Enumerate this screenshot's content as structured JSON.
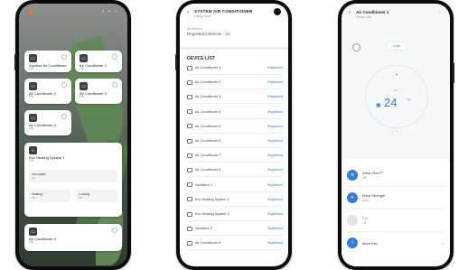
{
  "phone1": {
    "cards": [
      {
        "title": "Outdoor Air Conditioner",
        "subtitle": "Off"
      },
      {
        "title": "Air Conditioner 2",
        "subtitle": "Off"
      },
      {
        "title": "Air Conditioner 3",
        "subtitle": "Off"
      },
      {
        "title": "Air Conditioner 4",
        "subtitle": "Off"
      },
      {
        "title": "Air Conditioner 5",
        "subtitle": "Off"
      },
      {
        "title": "Eco Heating System 1",
        "subtitle": "Off"
      },
      {
        "title": "Air Conditioner 6",
        "subtitle": "Off"
      }
    ],
    "mini": [
      {
        "title": "Hot Water",
        "subtitle": "Off"
      },
      {
        "title": "Heating",
        "subtitle": "Off"
      },
      {
        "title": "Cooling",
        "subtitle": "Off"
      }
    ]
  },
  "phone2": {
    "title": "SYSTEM AIR CONDITIONER",
    "subtitle": "Living room",
    "location_label": "All devices",
    "location_value": "Registered devices : 13",
    "list_title": "DEVICE LIST",
    "devices": [
      {
        "name": "Air Conditioner 1",
        "status": "Registered"
      },
      {
        "name": "Air Conditioner 2",
        "status": "Registered"
      },
      {
        "name": "Air Conditioner 3",
        "status": "Registered"
      },
      {
        "name": "Air Conditioner 4",
        "status": "Registered"
      },
      {
        "name": "Air Conditioner 5",
        "status": "Registered"
      },
      {
        "name": "Air Conditioner 6",
        "status": "Registered"
      },
      {
        "name": "Air Conditioner 7",
        "status": "Registered"
      },
      {
        "name": "Air Conditioner 8",
        "status": "Registered"
      },
      {
        "name": "Ventilator 1",
        "status": "Registered"
      },
      {
        "name": "Eco Heating System 1",
        "status": "Registered"
      },
      {
        "name": "Eco Heating System 2",
        "status": "Registered"
      },
      {
        "name": "Ventilator 2",
        "status": "Registered"
      },
      {
        "name": "Air Conditioner 9",
        "status": "Registered"
      }
    ]
  },
  "phone3": {
    "title": "Air Conditioner 1",
    "subtitle": "Living room",
    "mode": "Cool",
    "set_label": "Set",
    "temperature": "24",
    "unit": "°C",
    "options": [
      {
        "title": "Wind-Free™",
        "subtitle": "Off"
      },
      {
        "title": "Wind Strength",
        "subtitle": "Auto"
      },
      {
        "title": "Fan",
        "subtitle": "Off"
      },
      {
        "title": "More Info",
        "subtitle": ""
      }
    ]
  },
  "colors": {
    "accent": "#3a7bd5",
    "link": "#3d77c5",
    "alert_dot": "#ff6c3a"
  }
}
